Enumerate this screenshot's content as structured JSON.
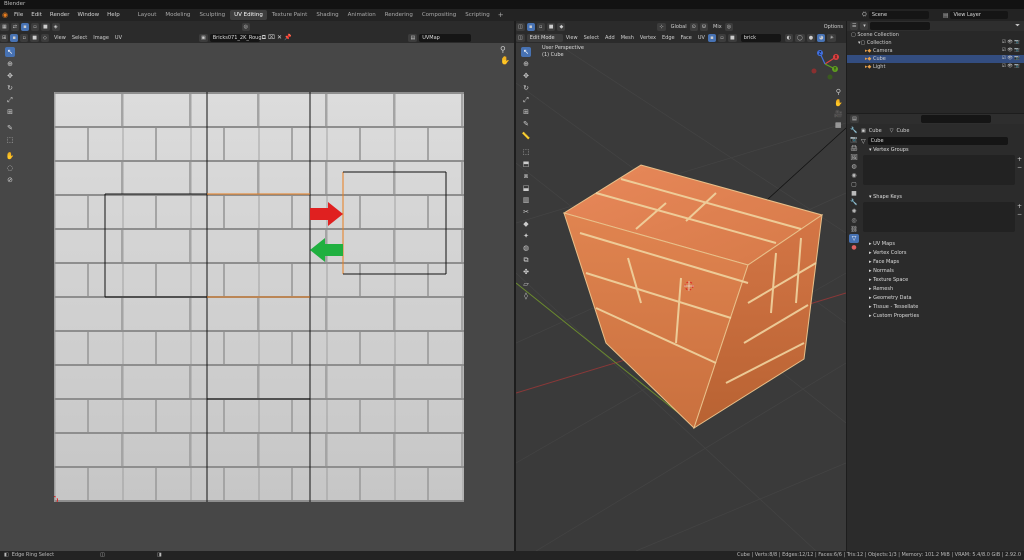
{
  "app": {
    "title": "Blender"
  },
  "menu": [
    "File",
    "Edit",
    "Render",
    "Window",
    "Help"
  ],
  "workspaces": [
    {
      "label": "Layout",
      "active": false
    },
    {
      "label": "Modeling",
      "active": false
    },
    {
      "label": "Sculpting",
      "active": false
    },
    {
      "label": "UV Editing",
      "active": true
    },
    {
      "label": "Texture Paint",
      "active": false
    },
    {
      "label": "Shading",
      "active": false
    },
    {
      "label": "Animation",
      "active": false
    },
    {
      "label": "Rendering",
      "active": false
    },
    {
      "label": "Compositing",
      "active": false
    },
    {
      "label": "Scripting",
      "active": false
    }
  ],
  "workspace_add": "+",
  "scene": {
    "name": "Scene",
    "view_layer": "View Layer"
  },
  "uv_editor": {
    "menus": [
      "View",
      "Select",
      "Image",
      "UV"
    ],
    "image_name": "Bricks071_2K_Roug...",
    "uvmap": "UVMap"
  },
  "viewport": {
    "mode": "Edit Mode",
    "menus": [
      "View",
      "Select",
      "Add",
      "Mesh",
      "Vertex",
      "Edge",
      "Face",
      "UV"
    ],
    "orientation": "Global",
    "pivot": "Mix",
    "search_value": "brick",
    "options_label": "Options",
    "overlay_title": "User Perspective",
    "overlay_object": "(1) Cube",
    "gizmo": {
      "x": "X",
      "y": "Y",
      "z": "Z"
    }
  },
  "outliner": {
    "items": [
      {
        "label": "Scene Collection",
        "indent": 0,
        "selected": false
      },
      {
        "label": "Collection",
        "indent": 1,
        "selected": false
      },
      {
        "label": "Camera",
        "indent": 2,
        "selected": false
      },
      {
        "label": "Cube",
        "indent": 2,
        "selected": true
      },
      {
        "label": "Light",
        "indent": 2,
        "selected": false
      }
    ]
  },
  "properties": {
    "breadcrumb_object": "Cube",
    "breadcrumb_mesh": "Cube",
    "mesh_name": "Cube",
    "panels_open": [
      "Vertex Groups",
      "Shape Keys"
    ],
    "panels_closed": [
      "UV Maps",
      "Vertex Colors",
      "Face Maps",
      "Normals",
      "Texture Space",
      "Remesh",
      "Geometry Data",
      "Tissue - Tessellate",
      "Custom Properties"
    ]
  },
  "status": {
    "left": "Edge Ring Select",
    "right": "Cube | Verts:8/8 | Edges:12/12 | Faces:6/6 | Tris:12 | Objects:1/3 | Memory: 101.2 MiB | VRAM: 5.4/8.0 GiB | 2.92.0"
  },
  "colors": {
    "accent": "#4772b3",
    "arrow_red": "#e02020",
    "arrow_green": "#20b040",
    "uv_edge_selected": "#e87d1e",
    "brick": "#e0824e"
  }
}
